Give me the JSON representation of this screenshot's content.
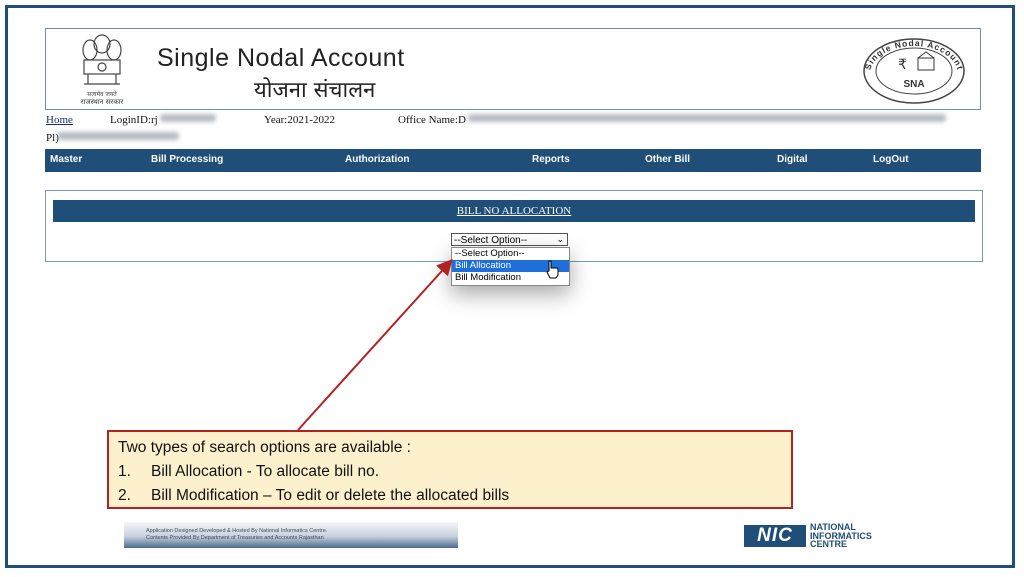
{
  "header": {
    "title_en": "Single Nodal Account",
    "title_hi": "योजना संचालन",
    "emblem_caption": "राजस्थान सरकार",
    "sna_logo_text": "SNA",
    "sna_ring_text": "Single Nodal Account"
  },
  "info": {
    "home_link": "Home",
    "login_label": "LoginID:rj",
    "year_label": "Year:2021-2022",
    "office_label": "Office Name:D",
    "second_line_prefix": "Pl",
    "second_line_suffix": ")"
  },
  "nav": {
    "items": [
      "Master",
      "Bill Processing",
      "Authorization",
      "Reports",
      "Other Bill",
      "Digital",
      "LogOut"
    ]
  },
  "panel": {
    "title": "BILL NO ALLOCATION",
    "select_value": "--Select Option--",
    "options": [
      "--Select Option--",
      "Bill Allocation",
      "Bill Modification"
    ],
    "highlighted_option": "Bill Allocation"
  },
  "callout": {
    "line1": "Two types of search options are available :",
    "item1_num": "1.",
    "item1_text": "Bill Allocation - To allocate bill no.",
    "item2_num": "2.",
    "item2_text": "Bill Modification – To edit or delete the allocated bills"
  },
  "footer": {
    "line1": "Application Designed Developed & Hosted By National Informatics Centre.",
    "line2": "Contents Provided By Department of Treasuries and Accounts Rajasthan",
    "nic_logo": "NIC",
    "nic_name_1": "NATIONAL",
    "nic_name_2": "INFORMATICS",
    "nic_name_3": "CENTRE"
  },
  "colors": {
    "navbar": "#1f4e79",
    "callout_bg": "#fdf0cd",
    "callout_border": "#b22222",
    "highlight": "#1e6fd9"
  },
  "icons": [
    "state-emblem-icon",
    "sna-logo-icon",
    "chevron-down-icon",
    "mouse-pointer-icon",
    "nic-logo-icon"
  ]
}
